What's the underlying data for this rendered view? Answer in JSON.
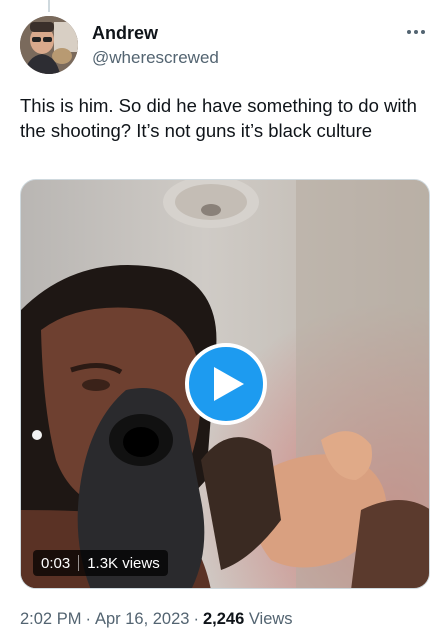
{
  "tweet": {
    "author": {
      "display_name": "Andrew",
      "handle": "@wherescrewed",
      "avatar": "avatar-photo"
    },
    "more_icon": "more-horizontal-icon",
    "text": "This is him. So did he have something to do with the shooting? It’s not guns it’s black culture",
    "media": {
      "type": "video",
      "play_icon": "play-icon",
      "duration": "0:03",
      "views_label": "1.3K views"
    },
    "timestamp": {
      "time": "2:02 PM",
      "separator": "·",
      "date": "Apr 16, 2023"
    },
    "views": {
      "count": "2,246",
      "label": "Views"
    }
  },
  "colors": {
    "accent": "#1d9bf0",
    "text_primary": "#0f1419",
    "text_secondary": "#536471",
    "border": "#cfd9de"
  }
}
